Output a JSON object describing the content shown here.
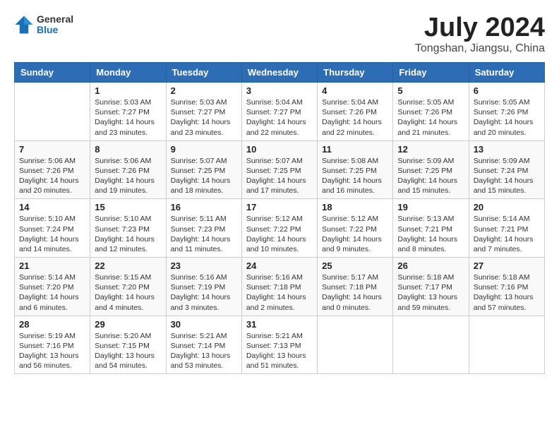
{
  "header": {
    "logo_general": "General",
    "logo_blue": "Blue",
    "month_year": "July 2024",
    "location": "Tongshan, Jiangsu, China"
  },
  "days_of_week": [
    "Sunday",
    "Monday",
    "Tuesday",
    "Wednesday",
    "Thursday",
    "Friday",
    "Saturday"
  ],
  "weeks": [
    [
      {
        "day": "",
        "info": ""
      },
      {
        "day": "1",
        "info": "Sunrise: 5:03 AM\nSunset: 7:27 PM\nDaylight: 14 hours\nand 23 minutes."
      },
      {
        "day": "2",
        "info": "Sunrise: 5:03 AM\nSunset: 7:27 PM\nDaylight: 14 hours\nand 23 minutes."
      },
      {
        "day": "3",
        "info": "Sunrise: 5:04 AM\nSunset: 7:27 PM\nDaylight: 14 hours\nand 22 minutes."
      },
      {
        "day": "4",
        "info": "Sunrise: 5:04 AM\nSunset: 7:26 PM\nDaylight: 14 hours\nand 22 minutes."
      },
      {
        "day": "5",
        "info": "Sunrise: 5:05 AM\nSunset: 7:26 PM\nDaylight: 14 hours\nand 21 minutes."
      },
      {
        "day": "6",
        "info": "Sunrise: 5:05 AM\nSunset: 7:26 PM\nDaylight: 14 hours\nand 20 minutes."
      }
    ],
    [
      {
        "day": "7",
        "info": "Sunrise: 5:06 AM\nSunset: 7:26 PM\nDaylight: 14 hours\nand 20 minutes."
      },
      {
        "day": "8",
        "info": "Sunrise: 5:06 AM\nSunset: 7:26 PM\nDaylight: 14 hours\nand 19 minutes."
      },
      {
        "day": "9",
        "info": "Sunrise: 5:07 AM\nSunset: 7:25 PM\nDaylight: 14 hours\nand 18 minutes."
      },
      {
        "day": "10",
        "info": "Sunrise: 5:07 AM\nSunset: 7:25 PM\nDaylight: 14 hours\nand 17 minutes."
      },
      {
        "day": "11",
        "info": "Sunrise: 5:08 AM\nSunset: 7:25 PM\nDaylight: 14 hours\nand 16 minutes."
      },
      {
        "day": "12",
        "info": "Sunrise: 5:09 AM\nSunset: 7:25 PM\nDaylight: 14 hours\nand 15 minutes."
      },
      {
        "day": "13",
        "info": "Sunrise: 5:09 AM\nSunset: 7:24 PM\nDaylight: 14 hours\nand 15 minutes."
      }
    ],
    [
      {
        "day": "14",
        "info": "Sunrise: 5:10 AM\nSunset: 7:24 PM\nDaylight: 14 hours\nand 14 minutes."
      },
      {
        "day": "15",
        "info": "Sunrise: 5:10 AM\nSunset: 7:23 PM\nDaylight: 14 hours\nand 12 minutes."
      },
      {
        "day": "16",
        "info": "Sunrise: 5:11 AM\nSunset: 7:23 PM\nDaylight: 14 hours\nand 11 minutes."
      },
      {
        "day": "17",
        "info": "Sunrise: 5:12 AM\nSunset: 7:22 PM\nDaylight: 14 hours\nand 10 minutes."
      },
      {
        "day": "18",
        "info": "Sunrise: 5:12 AM\nSunset: 7:22 PM\nDaylight: 14 hours\nand 9 minutes."
      },
      {
        "day": "19",
        "info": "Sunrise: 5:13 AM\nSunset: 7:21 PM\nDaylight: 14 hours\nand 8 minutes."
      },
      {
        "day": "20",
        "info": "Sunrise: 5:14 AM\nSunset: 7:21 PM\nDaylight: 14 hours\nand 7 minutes."
      }
    ],
    [
      {
        "day": "21",
        "info": "Sunrise: 5:14 AM\nSunset: 7:20 PM\nDaylight: 14 hours\nand 6 minutes."
      },
      {
        "day": "22",
        "info": "Sunrise: 5:15 AM\nSunset: 7:20 PM\nDaylight: 14 hours\nand 4 minutes."
      },
      {
        "day": "23",
        "info": "Sunrise: 5:16 AM\nSunset: 7:19 PM\nDaylight: 14 hours\nand 3 minutes."
      },
      {
        "day": "24",
        "info": "Sunrise: 5:16 AM\nSunset: 7:18 PM\nDaylight: 14 hours\nand 2 minutes."
      },
      {
        "day": "25",
        "info": "Sunrise: 5:17 AM\nSunset: 7:18 PM\nDaylight: 14 hours\nand 0 minutes."
      },
      {
        "day": "26",
        "info": "Sunrise: 5:18 AM\nSunset: 7:17 PM\nDaylight: 13 hours\nand 59 minutes."
      },
      {
        "day": "27",
        "info": "Sunrise: 5:18 AM\nSunset: 7:16 PM\nDaylight: 13 hours\nand 57 minutes."
      }
    ],
    [
      {
        "day": "28",
        "info": "Sunrise: 5:19 AM\nSunset: 7:16 PM\nDaylight: 13 hours\nand 56 minutes."
      },
      {
        "day": "29",
        "info": "Sunrise: 5:20 AM\nSunset: 7:15 PM\nDaylight: 13 hours\nand 54 minutes."
      },
      {
        "day": "30",
        "info": "Sunrise: 5:21 AM\nSunset: 7:14 PM\nDaylight: 13 hours\nand 53 minutes."
      },
      {
        "day": "31",
        "info": "Sunrise: 5:21 AM\nSunset: 7:13 PM\nDaylight: 13 hours\nand 51 minutes."
      },
      {
        "day": "",
        "info": ""
      },
      {
        "day": "",
        "info": ""
      },
      {
        "day": "",
        "info": ""
      }
    ]
  ]
}
